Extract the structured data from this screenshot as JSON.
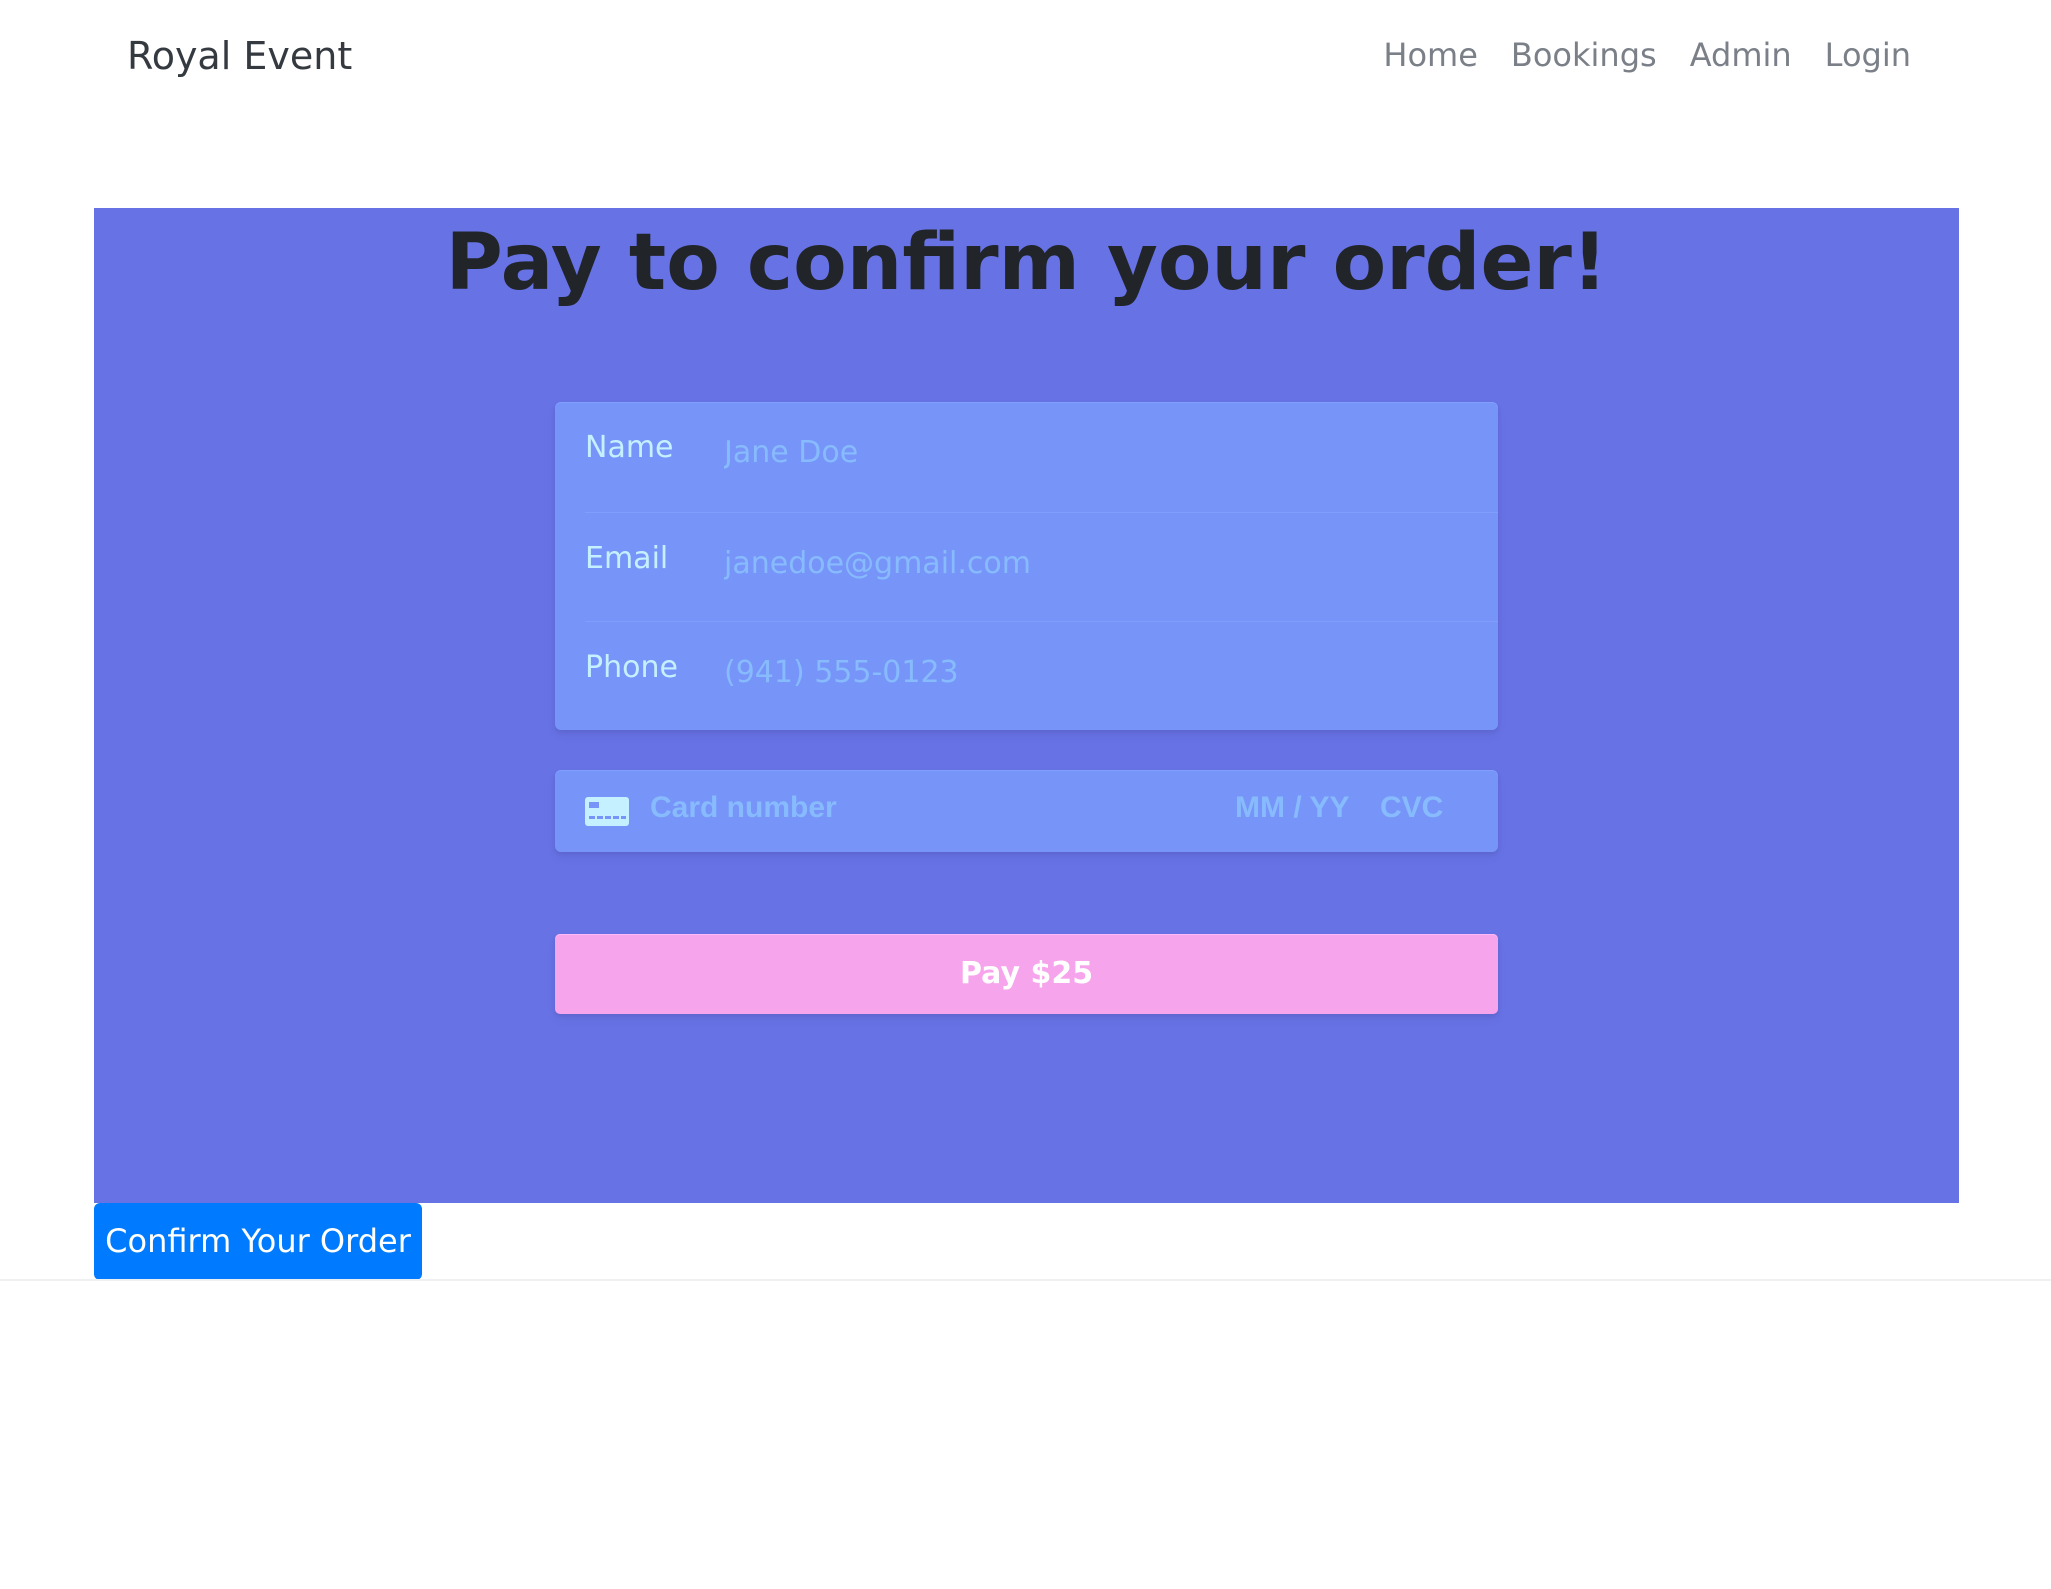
{
  "navbar": {
    "brand": "Royal Event",
    "links": [
      {
        "label": "Home"
      },
      {
        "label": "Bookings"
      },
      {
        "label": "Admin"
      },
      {
        "label": "Login"
      }
    ]
  },
  "hero": {
    "title": "Pay to confirm your order!",
    "background_color": "#6772e5",
    "fields": [
      {
        "label": "Name",
        "placeholder": "Jane Doe"
      },
      {
        "label": "Email",
        "placeholder": "janedoe@gmail.com"
      },
      {
        "label": "Phone",
        "placeholder": "(941) 555-0123"
      }
    ],
    "card": {
      "icon": "credit-card-icon",
      "number_placeholder": "Card number",
      "expiry_placeholder": "MM / YY",
      "cvc_placeholder": "CVC"
    },
    "pay_button": {
      "label": "Pay $25",
      "color": "#f6a4eb"
    }
  },
  "confirm_button": {
    "label": "Confirm Your Order",
    "color": "#007bff"
  }
}
